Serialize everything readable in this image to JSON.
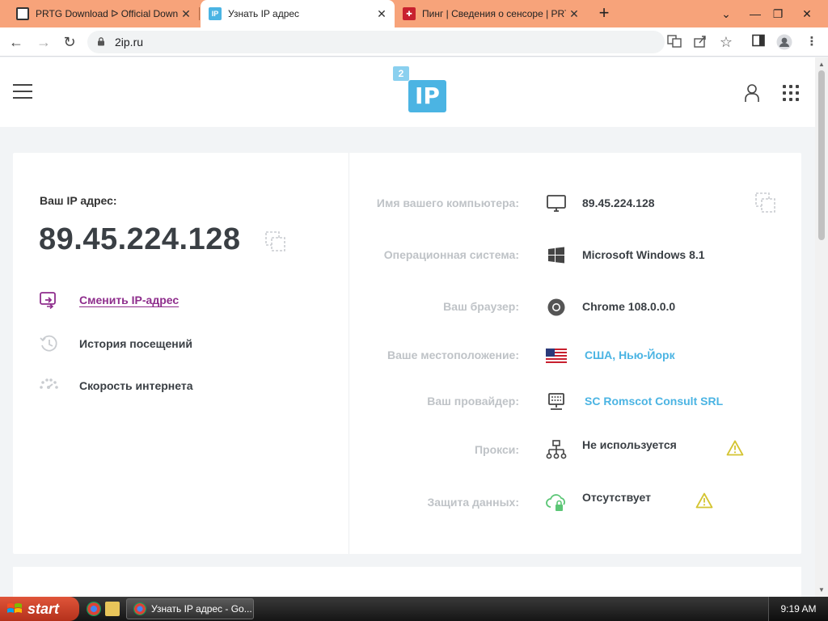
{
  "browser": {
    "tabs": [
      {
        "title": "PRTG Download ᐅ Official Down",
        "favicon": "prtg-favicon"
      },
      {
        "title": "Узнать IP адрес",
        "favicon": "2ip-favicon",
        "active": true
      },
      {
        "title": "Пинг | Сведения о сенсоре | PRT",
        "favicon": "prtg-red-favicon"
      }
    ],
    "new_tab": "+",
    "url": "2ip.ru",
    "colors": {
      "tabstrip": "#f7a37a",
      "accent": "#4bb4e3"
    }
  },
  "site": {
    "logo_big": "IP",
    "logo_small": "2",
    "ip_label": "Ваш IP адрес:",
    "ip_value": "89.45.224.128",
    "actions": [
      {
        "label": "Сменить IP-адрес",
        "icon": "switch-ip-icon",
        "link": true
      },
      {
        "label": "История посещений",
        "icon": "history-icon"
      },
      {
        "label": "Скорость интернета",
        "icon": "speed-icon"
      }
    ],
    "details": [
      {
        "key": "Имя вашего компьютера:",
        "value": "89.45.224.128",
        "icon": "monitor-icon"
      },
      {
        "key": "Операционная система:",
        "value": "Microsoft Windows 8.1",
        "icon": "windows-icon"
      },
      {
        "key": "Ваш браузер:",
        "value": "Chrome 108.0.0.0",
        "icon": "chrome-icon"
      },
      {
        "key": "Ваше местоположение:",
        "value": "США, Нью-Йорк",
        "icon": "us-flag-icon"
      },
      {
        "key": "Ваш провайдер:",
        "value": "SC Romscot Consult SRL",
        "icon": "server-icon"
      },
      {
        "key": "Прокси:",
        "value": "Не используется",
        "icon": "proxy-icon"
      },
      {
        "key": "Защита данных:",
        "value": "Отсутствует",
        "icon": "cloud-lock-icon"
      }
    ]
  },
  "taskbar": {
    "start": "start",
    "task_title": "Узнать IP адрес - Go...",
    "clock": "9:19 AM"
  }
}
